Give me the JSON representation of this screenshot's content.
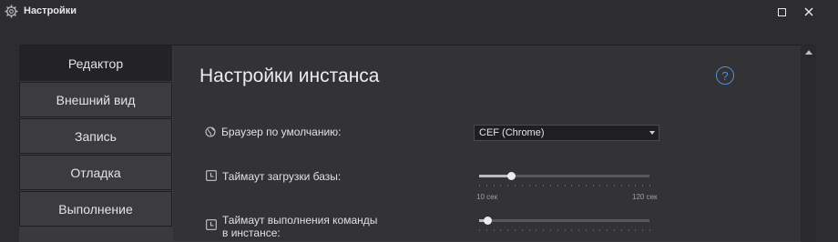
{
  "window": {
    "title": "Настройки"
  },
  "sidebar": {
    "items": [
      {
        "label": "Редактор",
        "active": true
      },
      {
        "label": "Внешний вид",
        "active": false
      },
      {
        "label": "Запись",
        "active": false
      },
      {
        "label": "Отладка",
        "active": false
      },
      {
        "label": "Выполнение",
        "active": false
      }
    ]
  },
  "main": {
    "title": "Настройки инстанса",
    "help_glyph": "?",
    "browser": {
      "label": "Браузер по умолчанию:",
      "value": "CEF (Chrome)",
      "icon": "globe-icon"
    },
    "base_timeout": {
      "label": "Таймаут загрузки базы:",
      "min_label": "10 сек",
      "max_label": "120 сек",
      "level": 0.19,
      "icon": "clock-icon"
    },
    "command_timeout": {
      "label_line1": "Таймаут выполнения команды",
      "label_line2": "в инстансе:",
      "level": 0.05,
      "icon": "clock-icon"
    }
  },
  "colors": {
    "accent": "#4a8fe0",
    "panel": "#333336",
    "sidebar_active": "#232325"
  }
}
